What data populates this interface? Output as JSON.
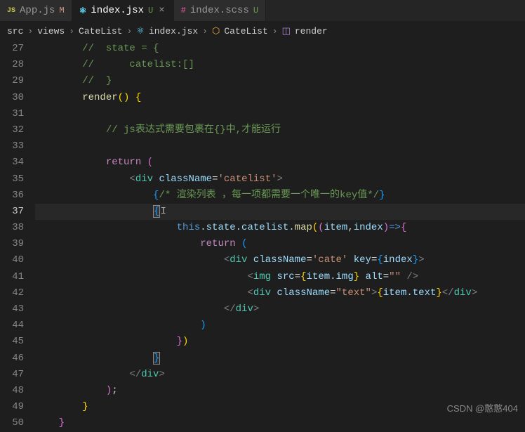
{
  "tabs": [
    {
      "icon": "JS",
      "label": "App.js",
      "status": "M"
    },
    {
      "icon": "⚛",
      "label": "index.jsx",
      "status": "U"
    },
    {
      "icon": "#",
      "label": "index.scss",
      "status": "U"
    }
  ],
  "breadcrumbs": [
    "src",
    "views",
    "CateList",
    "index.jsx",
    "CateList",
    "render"
  ],
  "line_start": 28,
  "line_end": 50,
  "active_line": 37,
  "watermark": "CSDN @憨憨404",
  "code": {
    "l27c": "//  state = {",
    "l28c": "//      catelist:[]",
    "l29c": "//  }",
    "l30_render": "render",
    "l32c": "// js表达式需要包裹在{}中,才能运行",
    "l34_return": "return",
    "l35_div": "div",
    "l35_cn": "className",
    "l35_val": "'catelist'",
    "l36c": "{/* 渲染列表 ，每一项都需要一个唯一的key值*/}",
    "l38_this": "this",
    "l38_state": ".state.catelist.",
    "l38_map": "map",
    "l38_item": "item",
    "l38_index": "index",
    "l39_return": "return",
    "l40_div": "div",
    "l40_cn": "className",
    "l40_val": "'cate'",
    "l40_key": "key",
    "l40_index": "index",
    "l41_img": "img",
    "l41_src": "src",
    "l41_item": "item",
    "l41_imgp": ".img",
    "l41_alt": "alt",
    "l41_altv": "\"\"",
    "l42_div": "div",
    "l42_cn": "className",
    "l42_val": "\"text\"",
    "l42_item": "item",
    "l42_text": ".text",
    "l43_div": "div",
    "l47_div": "div"
  }
}
